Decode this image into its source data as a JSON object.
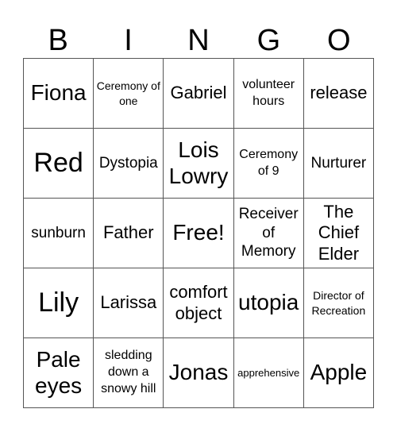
{
  "header": [
    "B",
    "I",
    "N",
    "G",
    "O"
  ],
  "cells": [
    [
      "Fiona",
      "Ceremony of one",
      "Gabriel",
      "volunteer hours",
      "release"
    ],
    [
      "Red",
      "Dystopia",
      "Lois Lowry",
      "Ceremony of 9",
      "Nurturer"
    ],
    [
      "sunburn",
      "Father",
      "Free!",
      "Receiver of Memory",
      "The Chief Elder"
    ],
    [
      "Lily",
      "Larissa",
      "comfort object",
      "utopia",
      "Director of Recreation"
    ],
    [
      "Pale eyes",
      "sledding down a snowy hill",
      "Jonas",
      "apprehensive",
      "Apple"
    ]
  ]
}
